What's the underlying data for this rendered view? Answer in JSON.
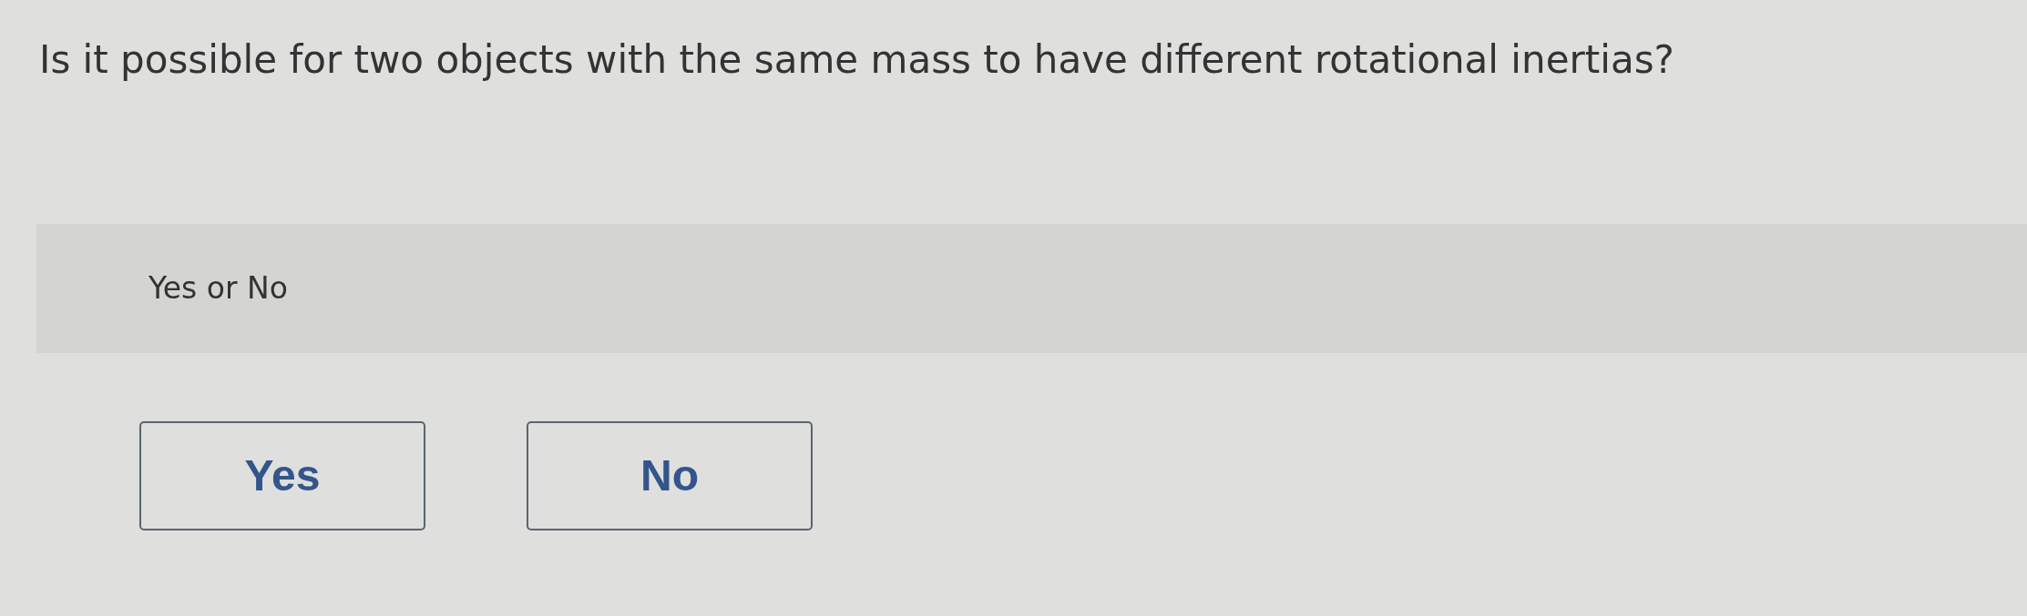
{
  "question": "Is it possible for two objects with the same mass to have different rotational inertias?",
  "prompt": "Yes or No",
  "options": [
    {
      "label": "Yes",
      "selected": false
    },
    {
      "label": "No",
      "selected": false
    }
  ]
}
